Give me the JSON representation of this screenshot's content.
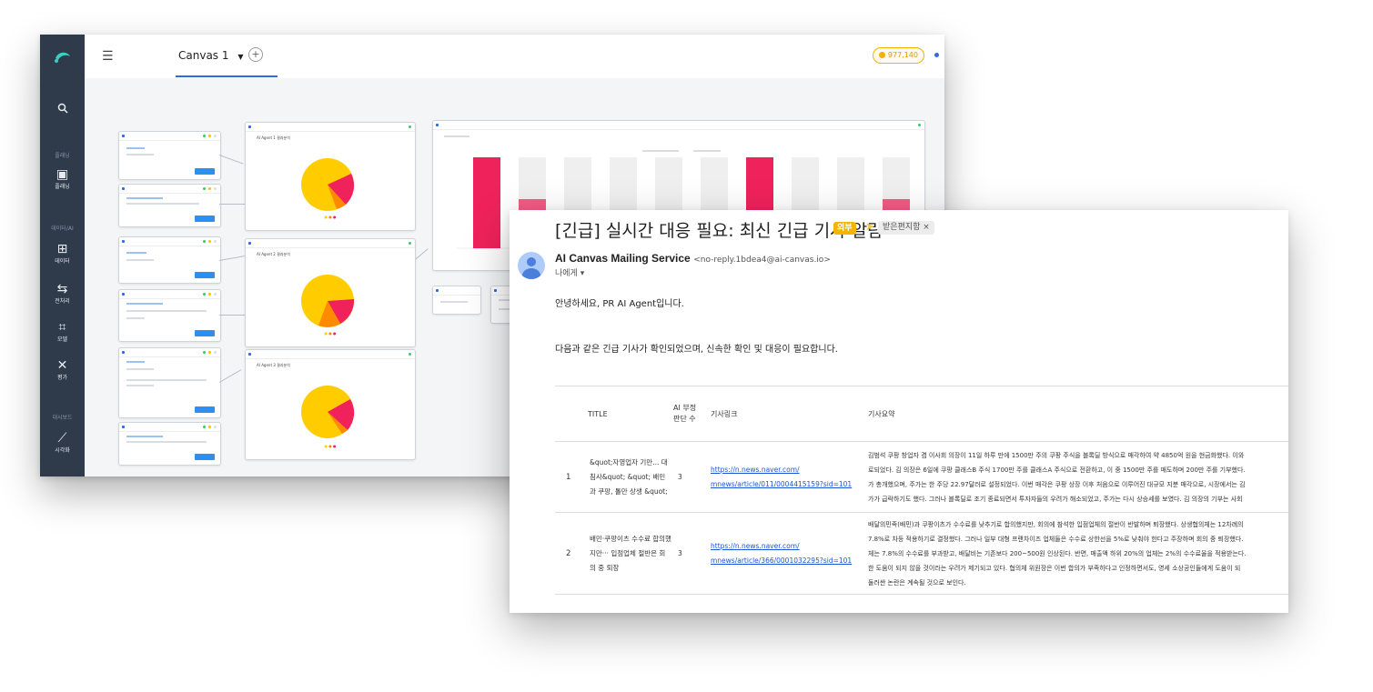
{
  "app": {
    "tab_label": "Canvas 1",
    "tab_dropdown_icon": "caret-down-icon",
    "add_tab_label": "+",
    "credits": "977,140",
    "sidebar": {
      "search_icon": "search-icon",
      "section_planning": "플래닝",
      "planning_label": "플래닝",
      "section_data_ai": "데이터/AI",
      "data_label": "데이터",
      "preprocess_label": "전처리",
      "model_label": "모델",
      "eval_label": "평가",
      "section_dashboard": "대시보드",
      "viz_label": "시각화"
    },
    "nodes": {
      "agent1_title": "AI Agent 1 결과분석",
      "agent2_title": "AI Agent 2 결과분석",
      "agent3_title": "AI Agent 3 결과분석"
    }
  },
  "mail": {
    "subject": "[긴급] 실시간 대응 필요: 최신 긴급 기사 알람",
    "tag_external": "외부",
    "tag_inbox": "받은편지함 ×",
    "sender_name": "AI Canvas Mailing Service",
    "sender_address": "<no-reply.1bdea4@ai-canvas.io>",
    "recipient": "나에게 ▾",
    "greeting": "안녕하세요, PR AI Agent입니다.",
    "intro": "다음과 같은 긴급 기사가 확인되었으며, 신속한 확인 및 대응이 필요합니다.",
    "columns": {
      "title": "TITLE",
      "count": "AI 부정 판단 수",
      "link": "기사링크",
      "summary": "기사요약"
    },
    "rows": [
      {
        "no": "1",
        "title": "&quot;자영업자 기만... 대침사&quot; &quot; 배민과 쿠팡, 톨만 상생 &quot;",
        "count": "3",
        "link": "https://n.news.naver.com/ mnews/article/011/0004415159?sid=101",
        "summary": [
          "김범석 쿠팡 창업자 겸 이사회 의장이 11일 하루 만에 1500만 주의 쿠팡 주식을 블록딜 방식으로 매각하여 약 4850억 원을 현금화했다. 이와",
          "로되었다. 김 의장은 6일에 쿠팡 클래스B 주식 1700만 주를 클래스A 주식으로 전환하고, 이 중 1500만 주를 매도하며 200만 주를 기부했다.",
          "가 총개했으며, 주가는 한 주당 22.97달러로 설정되었다. 이번 매각은 쿠팡 상장 이후 처음으로 이루어진 대규모 지분 매각으로, 시장에서는 김",
          "가가 급락하기도 했다. 그러나 블록딜로 조기 종료되면서 투자자들의 우려가 해소되었고, 주가는 다시 상승세를 보였다. 김 의장의 기부는 사회"
        ]
      },
      {
        "no": "2",
        "title": "배민·쿠팡이츠 수수료 합의했지만··· 입점업체 절반은 회의 중 퇴장",
        "count": "3",
        "link": "https://n.news.naver.com/ mnews/article/366/0001032295?sid=101",
        "summary": [
          "배달의민족(배민)과 쿠팡이츠가 수수료를 낮추기로 합의했지만, 회의에 참석한 입점업체의 절반이 반발하며 퇴장했다. 상생협의체는 12차례의",
          "7.8%로 차등 적용하기로 결정했다. 그러나 일부 대형 프랜차이즈 업체들은 수수료 상한선을 5%로 낮춰야 한다고 주장하며 회의 중 퇴장했다.",
          "체는 7.8%의 수수료를 부과받고, 배달비는 기존보다 200~500원 인상된다. 반면, 매출액 하위 20%의 업체는 2%의 수수료율을 적용받는다.",
          "한 도움이 되지 않을 것이라는 우려가 제기되고 있다. 협의체 위원장은 이번 합의가 부족하다고 인정하면서도, 영세 소상공인들에게 도움이 되",
          "둘러싼 논란은 계속될 것으로 보인다."
        ]
      }
    ]
  }
}
